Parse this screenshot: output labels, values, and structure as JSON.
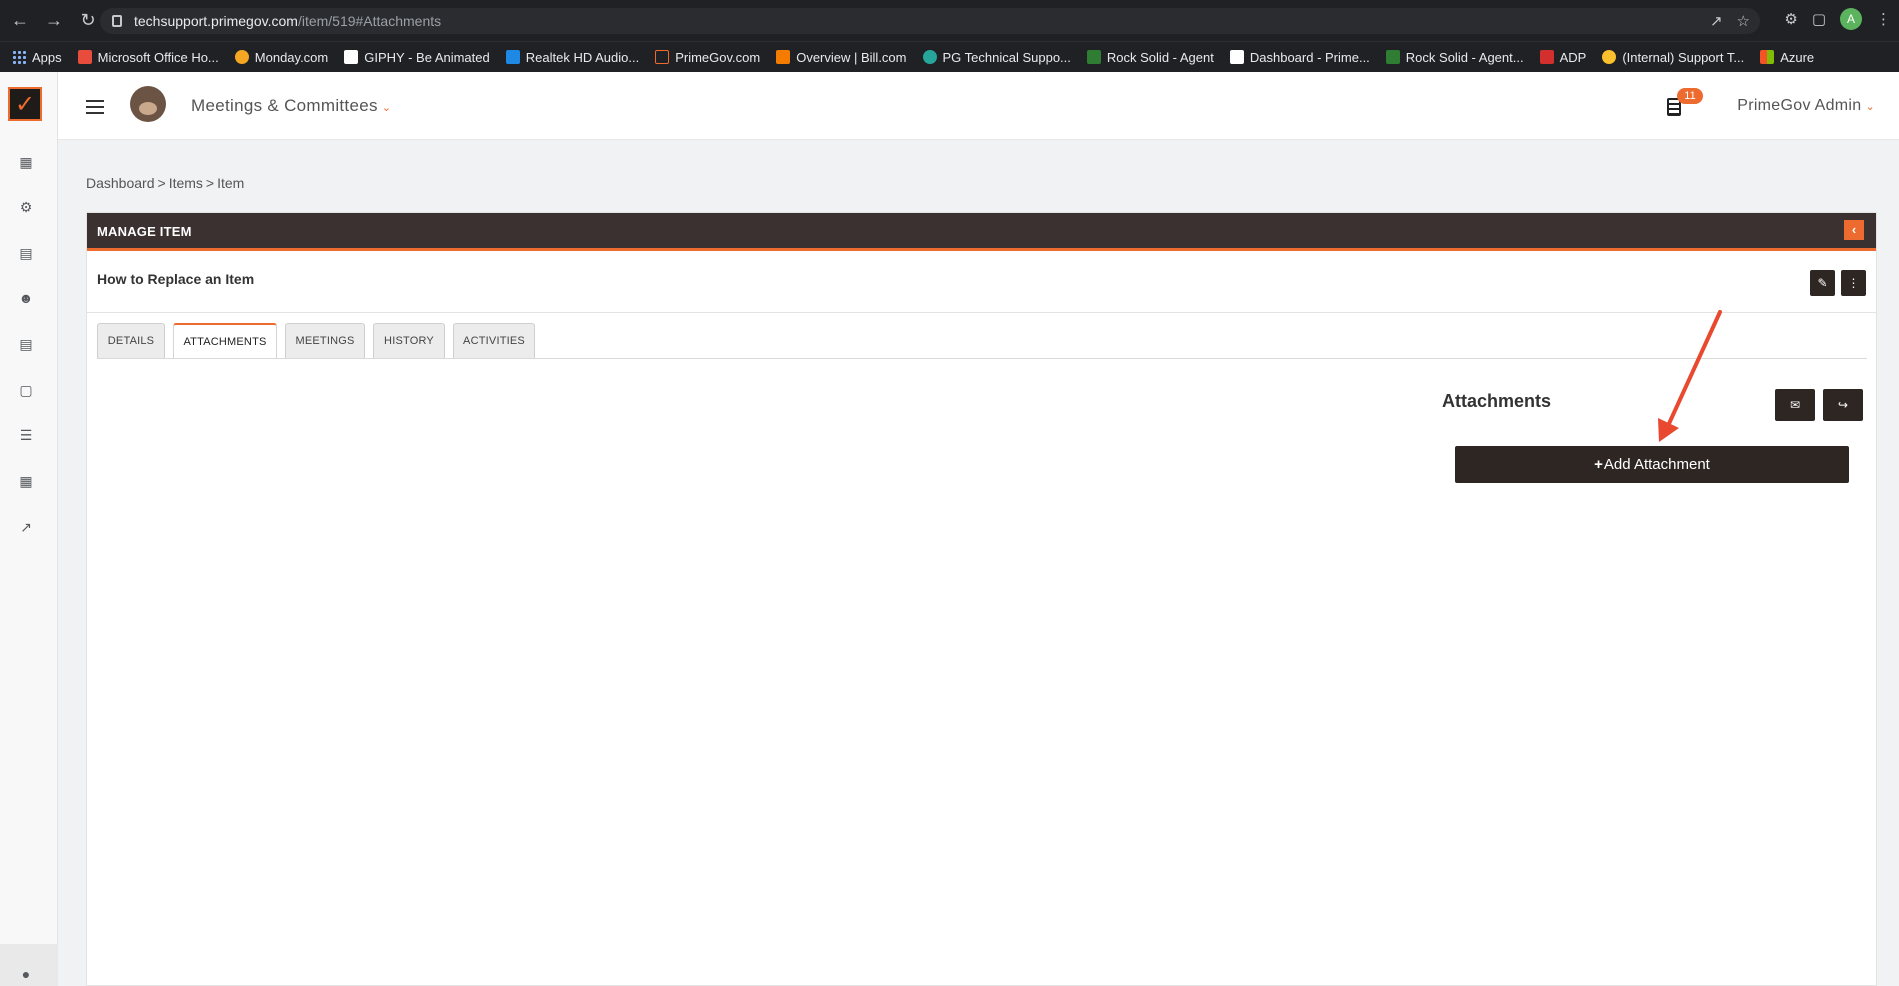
{
  "browser": {
    "url_host": "techsupport.primegov.com",
    "url_path": "/item/519#Attachments",
    "avatar_letter": "A"
  },
  "bookmarks": [
    {
      "label": "Apps",
      "color": "#8ab4f8"
    },
    {
      "label": "Microsoft Office Ho...",
      "color": "#e74c3c"
    },
    {
      "label": "Monday.com",
      "color": "#f5a623"
    },
    {
      "label": "GIPHY - Be Animated",
      "color": "#ffffff"
    },
    {
      "label": "Realtek HD Audio...",
      "color": "#1e88e5"
    },
    {
      "label": "PrimeGov.com",
      "color": "#ed6b2e"
    },
    {
      "label": "Overview | Bill.com",
      "color": "#f57c00"
    },
    {
      "label": "PG Technical Suppo...",
      "color": "#26a69a"
    },
    {
      "label": "Rock Solid - Agent",
      "color": "#2e7d32"
    },
    {
      "label": "Dashboard - Prime...",
      "color": "#ed6b2e"
    },
    {
      "label": "Rock Solid - Agent...",
      "color": "#2e7d32"
    },
    {
      "label": "ADP",
      "color": "#d32f2f"
    },
    {
      "label": "(Internal) Support T...",
      "color": "#fbc02d"
    },
    {
      "label": "Azure",
      "color": "#4caf50"
    }
  ],
  "header": {
    "module": "Meetings & Committees",
    "notif_count": "11",
    "user": "PrimeGov Admin"
  },
  "breadcrumb": [
    "Dashboard",
    "Items",
    "Item"
  ],
  "card": {
    "title": "MANAGE ITEM",
    "item_title": "How to Replace an Item"
  },
  "tabs": [
    "DETAILS",
    "ATTACHMENTS",
    "MEETINGS",
    "HISTORY",
    "ACTIVITIES"
  ],
  "attachments": {
    "heading": "Attachments",
    "add_label": "Add Attachment"
  },
  "colors": {
    "accent": "#ed6b2e",
    "dark": "#3b3130",
    "annotation_arrow": "#e8492f"
  }
}
